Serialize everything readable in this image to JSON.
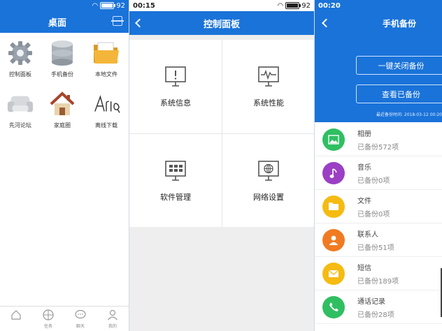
{
  "colors": {
    "accent": "#1a73d9",
    "green": "#2fbf61",
    "purple": "#9b3fc4",
    "yellow": "#f5bb12",
    "orange": "#f07b22"
  },
  "panel1": {
    "battery": "92",
    "title": "桌面",
    "apps": [
      {
        "label": "控制面板",
        "icon": "gear-icon"
      },
      {
        "label": "手机备份",
        "icon": "database-icon"
      },
      {
        "label": "本地文件",
        "icon": "folder-icon"
      },
      {
        "label": "先河论坛",
        "icon": "sofa-icon"
      },
      {
        "label": "家庭圈",
        "icon": "house-icon"
      },
      {
        "label": "离线下载",
        "icon": "aria-icon"
      }
    ],
    "nav": [
      {
        "label": "",
        "icon": "home-icon"
      },
      {
        "label": "任务",
        "icon": "compass-icon"
      },
      {
        "label": "聊天",
        "icon": "chat-icon"
      },
      {
        "label": "我的",
        "icon": "user-icon"
      }
    ]
  },
  "panel2": {
    "time": "00:15",
    "battery": "92",
    "title": "控制面板",
    "tiles": [
      {
        "label": "系统信息",
        "icon": "monitor-info-icon"
      },
      {
        "label": "系统性能",
        "icon": "monitor-pulse-icon"
      },
      {
        "label": "软件管理",
        "icon": "monitor-grid-icon"
      },
      {
        "label": "网络设置",
        "icon": "monitor-globe-icon"
      }
    ]
  },
  "panel3": {
    "time": "00:20",
    "title": "手机备份",
    "close_backup": "一键关闭备份",
    "view_backup": "查看已备份",
    "last_backup": "最近备份时间: 2018-03-12 00:20",
    "items": [
      {
        "name": "相册",
        "status": "已备份572项",
        "icon": "photo-icon",
        "color": "#2fbf61"
      },
      {
        "name": "音乐",
        "status": "已备份0项",
        "icon": "music-icon",
        "color": "#9b3fc4"
      },
      {
        "name": "文件",
        "status": "已备份0项",
        "icon": "file-icon",
        "color": "#f5bb12"
      },
      {
        "name": "联系人",
        "status": "已备份51项",
        "icon": "contact-icon",
        "color": "#f07b22"
      },
      {
        "name": "短信",
        "status": "已备份189项",
        "icon": "sms-icon",
        "color": "#f5bb12"
      },
      {
        "name": "通话记录",
        "status": "已备份28项",
        "icon": "phone-icon",
        "color": "#2fbf61"
      }
    ]
  }
}
